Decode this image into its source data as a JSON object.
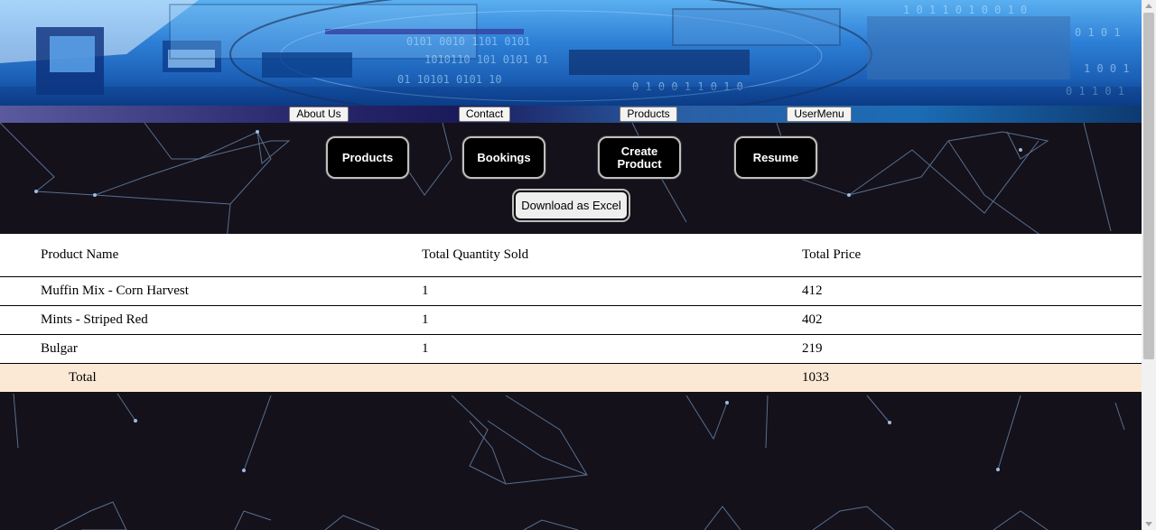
{
  "nav": {
    "items": [
      "About Us",
      "Contact",
      "Products",
      "UserMenu"
    ]
  },
  "actions": {
    "products": "Products",
    "bookings": "Bookings",
    "create_product": "Create\nProduct",
    "resume": "Resume",
    "download_excel": "Download as Excel"
  },
  "table": {
    "headers": [
      "Product Name",
      "Total Quantity Sold",
      "Total Price"
    ],
    "rows": [
      [
        "Muffin Mix - Corn Harvest",
        "1",
        "412"
      ],
      [
        "Mints - Striped Red",
        "1",
        "402"
      ],
      [
        "Bulgar",
        "1",
        "219"
      ]
    ],
    "total": {
      "label": "Total",
      "price": "1033"
    }
  },
  "colors": {
    "background": "#14111a",
    "total_row": "#fbe9d6",
    "button": "#000000"
  }
}
